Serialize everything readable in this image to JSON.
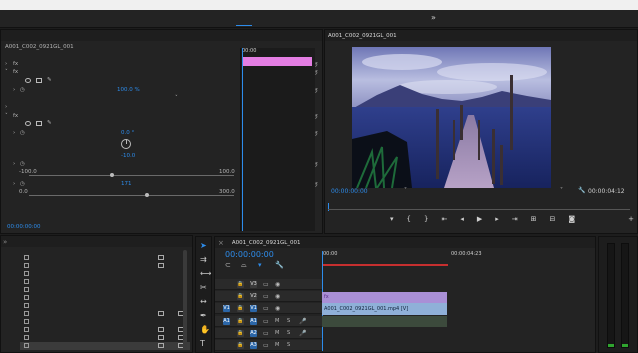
{
  "menubar": {
    "items": [
      "",
      "",
      "",
      "",
      "",
      "",
      "",
      "",
      ""
    ]
  },
  "workspaces": {
    "items": [
      "",
      "",
      "",
      "",
      "",
      "",
      ""
    ],
    "active_index": 1
  },
  "effect_controls": {
    "tabs": [
      "",
      "",
      "",
      ""
    ],
    "clip_path": "A001_C002_0921GL_001",
    "clip_name": "",
    "ruler_time": "00:00",
    "mini_clip_label": "",
    "opacity_value": "100.0 %",
    "blend_value": "",
    "hue_value": "0.0 °",
    "luma_value": "-10.0",
    "sat_value": "171",
    "range_min": "-100.0",
    "range_max": "100.0",
    "sat_min": "0.0",
    "sat_max": "300.0",
    "timecode": "00:00:00:00",
    "section_rows": [
      "",
      "",
      "",
      "",
      "",
      "",
      "",
      "",
      "",
      "",
      "",
      "",
      ""
    ]
  },
  "program_monitor": {
    "title": "A001_C002_0921GL_001",
    "timecode": "00:00:00:00",
    "fit": "",
    "quality": "",
    "duration": "00:00:04:12"
  },
  "effects_panel": {
    "tabs": [
      "",
      "",
      "",
      "",
      ""
    ],
    "items": [
      "",
      "",
      "",
      "",
      "",
      "",
      "",
      "",
      "",
      "",
      "",
      ""
    ]
  },
  "timeline": {
    "sequence_name": "A001_C002_0921GL_001",
    "timecode": "00:00:00:00",
    "ruler_start": "00:00",
    "ruler_mark": "00:00:04:23",
    "tracks": [
      {
        "label": "V3",
        "kind": "video"
      },
      {
        "label": "V2",
        "kind": "video"
      },
      {
        "label": "V1",
        "kind": "video"
      },
      {
        "label": "A1",
        "kind": "audio"
      },
      {
        "label": "A2",
        "kind": "audio"
      },
      {
        "label": "A3",
        "kind": "audio"
      }
    ],
    "source_v": "V1",
    "source_a": "A1",
    "clip_adjustment": "",
    "clip_video": "A001_C002_0921GL_001.mp4 [V]"
  },
  "colors": {
    "accent": "#2d8ceb",
    "adjustment_clip": "#a98fd6",
    "video_clip": "#8fb0d8",
    "mini_clip": "#e47ee3",
    "toggle_active": "#2b66a8"
  }
}
